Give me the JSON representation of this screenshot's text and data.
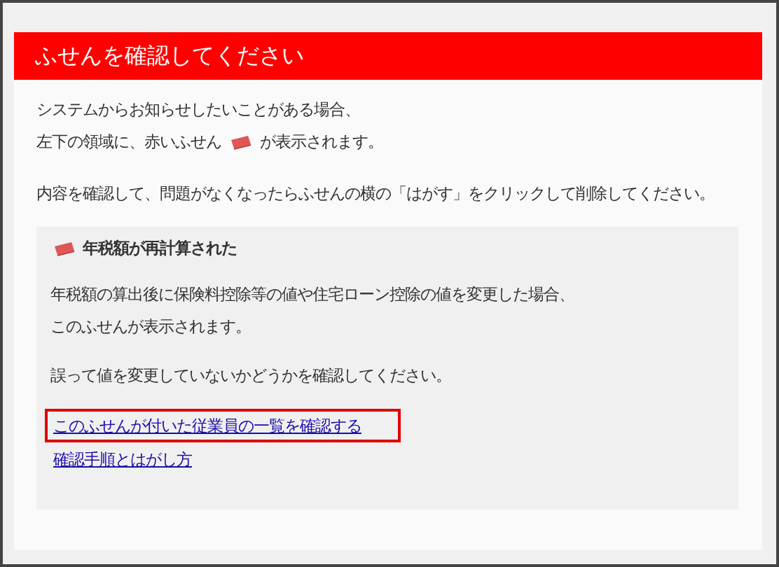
{
  "header": {
    "title": "ふせんを確認してください"
  },
  "intro": {
    "line_1": "システムからお知らせしたいことがある場合、",
    "line_2_before_icon": "左下の領域に、赤いふせん",
    "line_2_after_icon": "が表示されます。",
    "instruction": "内容を確認して、問題がなくなったらふせんの横の「はがす」をクリックして削除してください。"
  },
  "note": {
    "title": "年税額が再計算された",
    "paragraphs": [
      [
        "年税額の算出後に保険料控除等の値や住宅ローン控除の値を変更した場合、",
        "このふせんが表示されます。"
      ],
      [
        "誤って値を変更していないかどうかを確認してください。"
      ]
    ],
    "links": [
      {
        "label": "このふせんが付いた従業員の一覧を確認する",
        "highlighted": true
      },
      {
        "label": "確認手順とはがし方",
        "highlighted": false
      }
    ]
  }
}
